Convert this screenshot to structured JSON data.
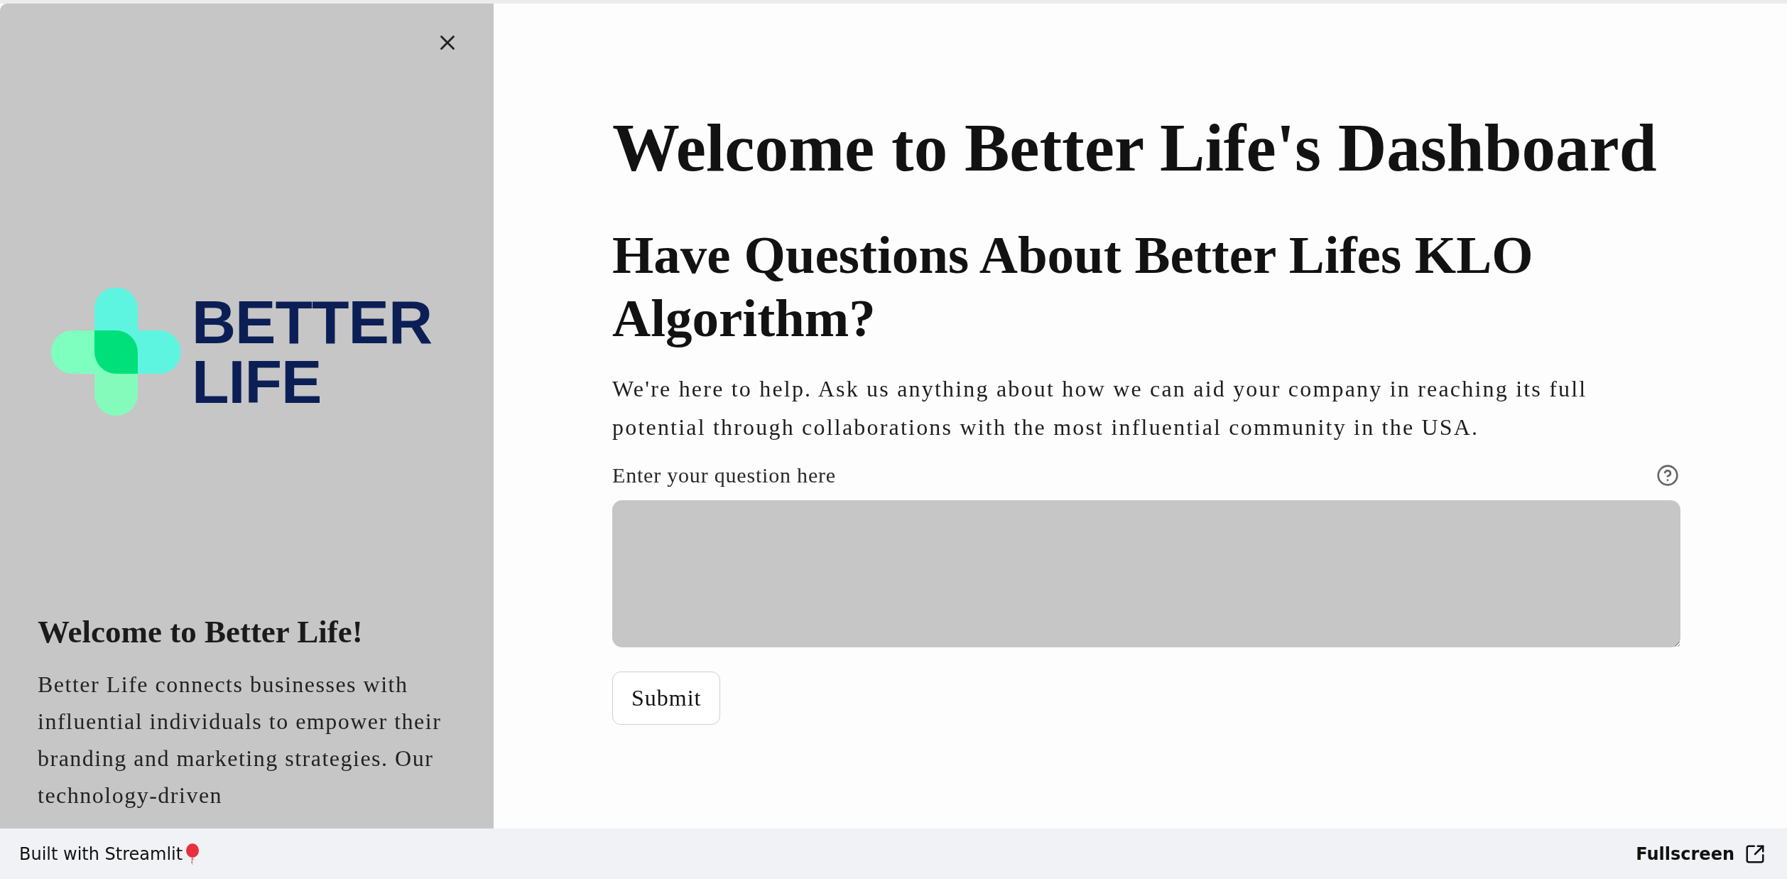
{
  "sidebar": {
    "logo_lines": [
      "BETTER",
      "LIFE"
    ],
    "heading": "Welcome to Better Life!",
    "text": "Better Life connects businesses with influential individuals to empower their branding and marketing strategies. Our technology-driven"
  },
  "main": {
    "title": "Welcome to Better Life's Dashboard",
    "subtitle": "Have Questions About Better Lifes KLO Algorithm?",
    "intro": "We're here to help. Ask us anything about how we can aid your company in reaching its full potential through collaborations with the most influential community in the USA.",
    "question_field": {
      "label": "Enter your question here"
    },
    "submit_button": "Submit"
  },
  "footer": {
    "credit": "Built with Streamlit",
    "fullscreen": "Fullscreen"
  }
}
